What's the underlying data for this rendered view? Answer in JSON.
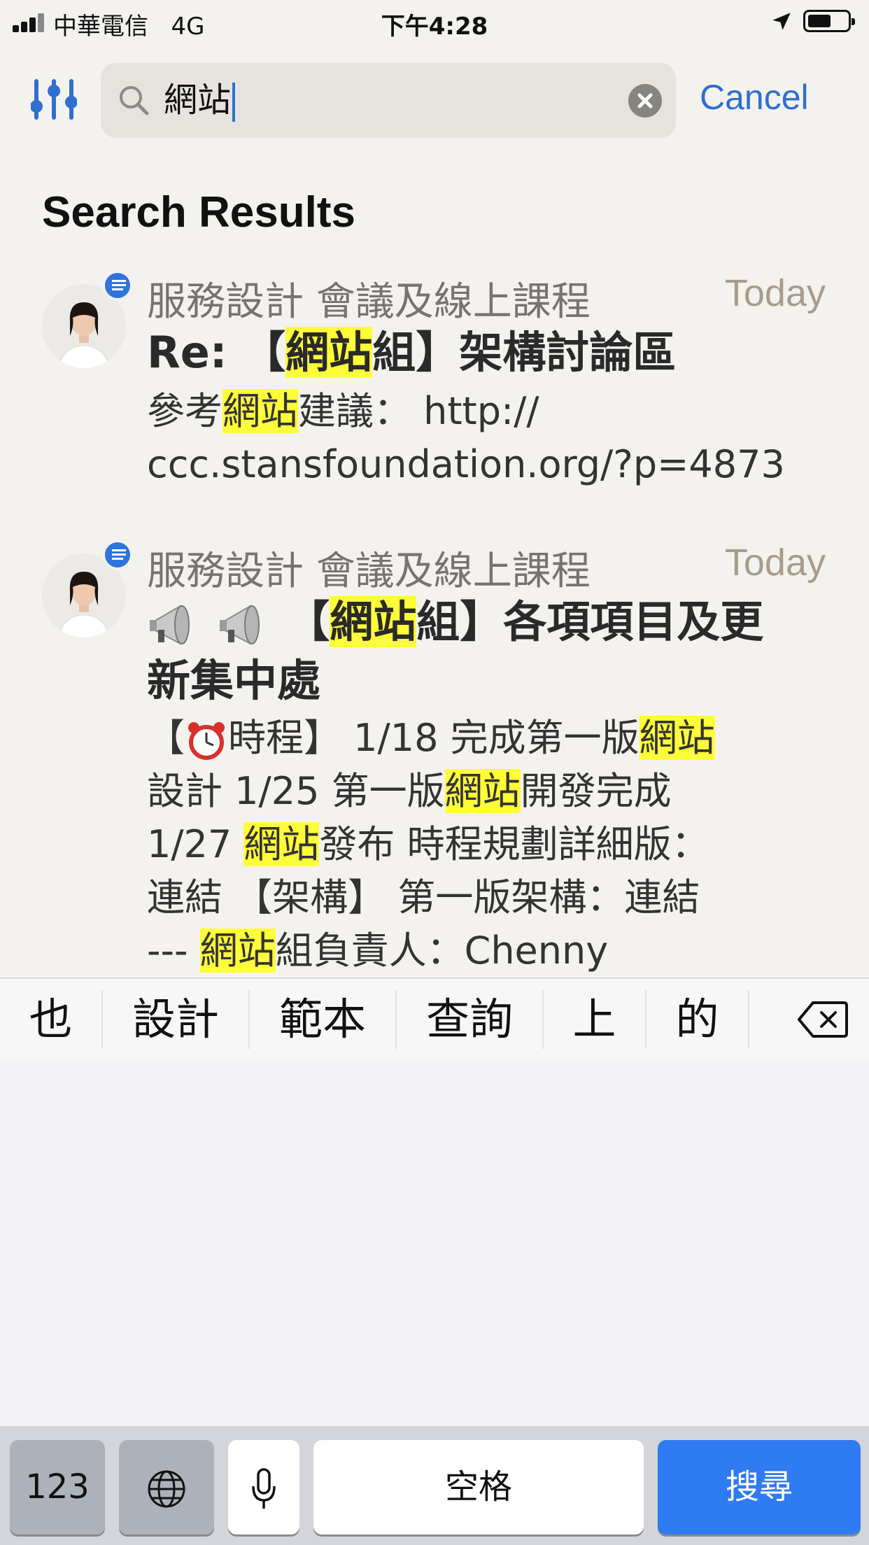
{
  "status_bar": {
    "carrier": "中華電信",
    "network": "4G",
    "time": "下午4:28"
  },
  "search": {
    "query": "網站",
    "cancel_label": "Cancel"
  },
  "section_title": "Search Results",
  "results": [
    {
      "group": "服務設計 會議及線上課程",
      "time": "Today",
      "title_prefix": "Re: 【",
      "title_highlight": "網站",
      "title_suffix": "組】架構討論區",
      "body_line1_a": "參考",
      "body_line1_hl": "網站",
      "body_line1_b": "建議： http://",
      "body_line2": "ccc.stansfoundation.org/?p=4873"
    },
    {
      "group": "服務設計 會議及線上課程",
      "time": "Today",
      "title_prefix": " 【",
      "title_highlight": "網站",
      "title_suffix": "組】各項項目及更",
      "title_line2": "新集中處",
      "body": {
        "l1a": "【",
        "l1b": "時程】 1/18 完成第一版",
        "l1hl": "網站",
        "l2a": "設計 1/25 第一版",
        "l2hl": "網站",
        "l2b": "開發完成",
        "l3a": "1/27 ",
        "l3hl": "網站",
        "l3b": "發布 時程規劃詳細版：",
        "l4": "連結 【架構】 第一版架構：連結",
        "l5a": "--- ",
        "l5hl": "網站",
        "l5b": "組負責人：Chenny"
      }
    }
  ],
  "candidates": [
    "也",
    "設計",
    "範本",
    "查詢",
    "上",
    "的"
  ],
  "keyboard": {
    "numbers_label": "123",
    "space_label": "空格",
    "search_label": "搜尋"
  },
  "icons": {
    "filter": "sliders-icon",
    "search": "magnifier-icon",
    "clear": "clear-x-icon",
    "backspace": "backspace-icon",
    "globe": "globe-icon",
    "mic": "microphone-icon",
    "location": "location-arrow-icon"
  },
  "colors": {
    "accent": "#2e6fd0",
    "highlight": "#fdfd3a",
    "search_key": "#2f7bf2"
  }
}
